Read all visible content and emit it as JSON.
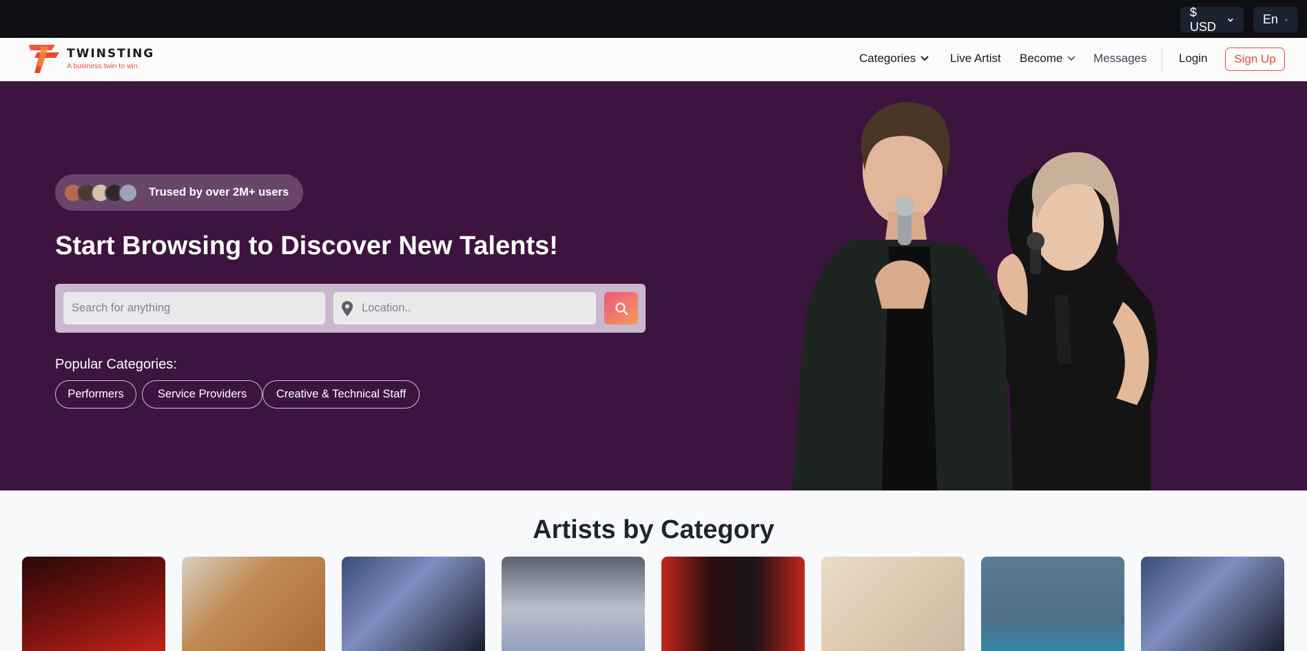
{
  "topbar": {
    "currency": "$ USD",
    "language": "En"
  },
  "brand": {
    "name": "TWINSTING",
    "tagline": "A business twin to win."
  },
  "nav": {
    "categories": "Categories",
    "live_artist": "Live Artist",
    "become": "Become",
    "messages": "Messages",
    "login": "Login",
    "signup": "Sign Up"
  },
  "hero": {
    "trust_text": "Trused by over 2M+ users",
    "title": "Start Browsing to Discover New Talents!",
    "search_placeholder": "Search for anything",
    "location_placeholder": "Location..",
    "popular_label": "Popular Categories:",
    "chips": [
      "Performers",
      "Service Providers",
      "Creative & Technical Staff"
    ]
  },
  "section": {
    "title": "Artists by Category"
  },
  "colors": {
    "topbar": "#0d0f14",
    "hero": "#3d1340",
    "accent": "#e0503c"
  }
}
